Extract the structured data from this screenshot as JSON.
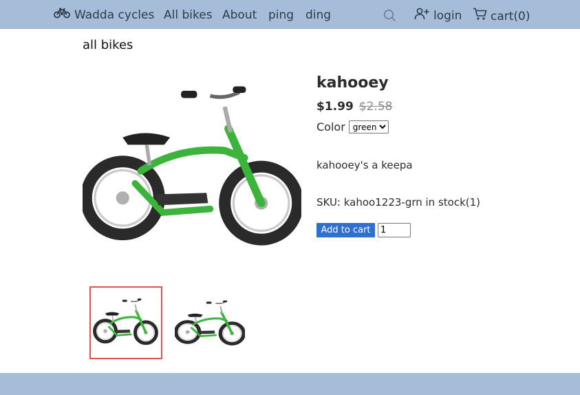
{
  "nav": {
    "brand": "Wadda cycles",
    "brand_icon": "bicycle-icon",
    "links": [
      "All bikes",
      "About",
      "ping",
      "ding"
    ],
    "search_icon": "search-icon",
    "login": "login",
    "login_icon": "add-user-icon",
    "cart": "cart(0)",
    "cart_icon": "cart-icon"
  },
  "breadcrumb": "all bikes",
  "product": {
    "title": "kahooey",
    "price": "$1.99",
    "old_price": "$2.58",
    "color_label": "Color",
    "color_selected": "green",
    "description": "kahooey's a keepa",
    "sku_text": "SKU: kahoo1223-grn in stock(1)",
    "add_to_cart": "Add to cart",
    "quantity": "1"
  },
  "colors": {
    "nav_bg": "#a5bdd8",
    "bike_green": "#3cb43c",
    "button_blue": "#2f6fd0",
    "thumb_selected_border": "#d9534f",
    "old_price_gray": "#8a8a8a"
  }
}
